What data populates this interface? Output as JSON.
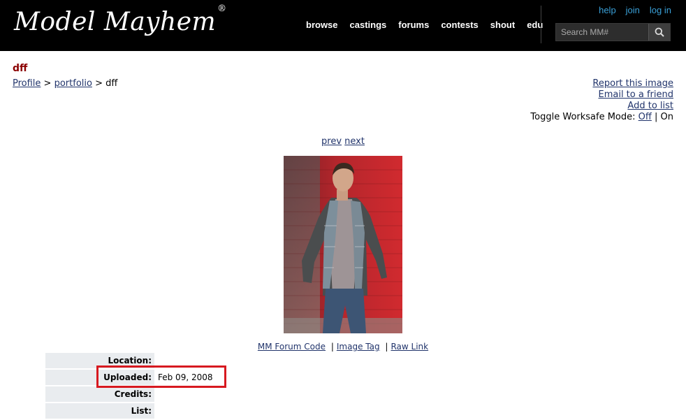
{
  "header": {
    "logo": "Model Mayhem",
    "logo_mark": "®",
    "nav": [
      "browse",
      "castings",
      "forums",
      "contests",
      "shout",
      "edu"
    ],
    "auth": [
      "help",
      "join",
      "log in"
    ],
    "search_placeholder": "Search MM#",
    "search_icon": "search-icon"
  },
  "page": {
    "title": "dff",
    "breadcrumb": {
      "profile": "Profile",
      "sep1": " > ",
      "portfolio": "portfolio",
      "sep2": " > ",
      "current": "dff"
    },
    "actions": {
      "report": "Report this image",
      "email": "Email to a friend",
      "add_list": "Add to list",
      "worksafe_label": "Toggle Worksafe Mode: ",
      "off": "Off",
      "sep": " | ",
      "on": "On"
    },
    "prev": "prev",
    "next": "next",
    "links": {
      "forum_code": "MM Forum Code",
      "image_tag": "Image Tag",
      "raw_link": "Raw Link",
      "sep": "|"
    },
    "details": [
      {
        "label": "Location:",
        "value": ""
      },
      {
        "label": "Uploaded:",
        "value": "Feb 09, 2008"
      },
      {
        "label": "Credits:",
        "value": ""
      },
      {
        "label": "List:",
        "value": ""
      }
    ]
  },
  "colors": {
    "header_bg": "#000000",
    "title": "#8b0000",
    "link": "#21346b",
    "auth_link": "#3aa0d8",
    "highlight": "#d71920",
    "label_bg": "#e9ecef"
  }
}
